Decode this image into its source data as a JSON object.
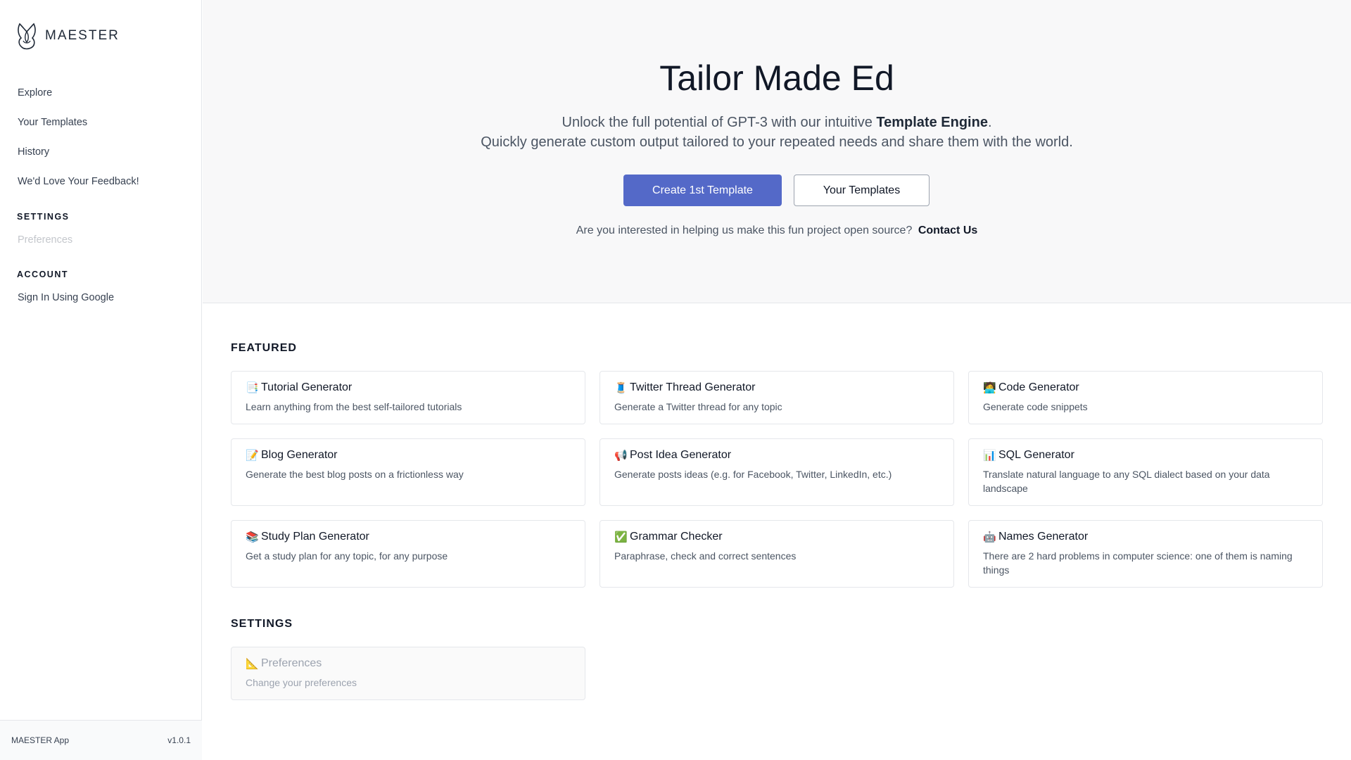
{
  "brand": {
    "name": "MAESTER"
  },
  "sidebar": {
    "nav": [
      {
        "label": "Explore"
      },
      {
        "label": "Your Templates"
      },
      {
        "label": "History"
      },
      {
        "label": "We'd Love Your Feedback!"
      }
    ],
    "settings_title": "SETTINGS",
    "preferences_label": "Preferences",
    "account_title": "ACCOUNT",
    "sign_in_label": "Sign In Using Google",
    "footer": {
      "app_name": "MAESTER App",
      "version": "v1.0.1"
    }
  },
  "hero": {
    "title": "Tailor Made Ed",
    "subtitle_line1_prefix": "Unlock the full potential of GPT-3 with our intuitive ",
    "subtitle_line1_bold": "Template Engine",
    "subtitle_line1_suffix": ".",
    "subtitle_line2": "Quickly generate custom output tailored to your repeated needs and share them with the world.",
    "primary_button": "Create 1st Template",
    "secondary_button": "Your Templates",
    "contact_text": "Are you interested in helping us make this fun project open source?",
    "contact_link": "Contact Us"
  },
  "featured": {
    "title": "FEATURED",
    "cards": [
      {
        "emoji": "📑",
        "title": "Tutorial Generator",
        "desc": "Learn anything from the best self-tailored tutorials"
      },
      {
        "emoji": "🧵",
        "title": "Twitter Thread Generator",
        "desc": "Generate a Twitter thread for any topic"
      },
      {
        "emoji": "🧑‍💻",
        "title": "Code Generator",
        "desc": "Generate code snippets"
      },
      {
        "emoji": "📝",
        "title": "Blog Generator",
        "desc": "Generate the best blog posts on a frictionless way"
      },
      {
        "emoji": "📢",
        "title": "Post Idea Generator",
        "desc": "Generate posts ideas (e.g. for Facebook, Twitter, LinkedIn, etc.)"
      },
      {
        "emoji": "📊",
        "title": "SQL Generator",
        "desc": "Translate natural language to any SQL dialect based on your data landscape"
      },
      {
        "emoji": "📚",
        "title": "Study Plan Generator",
        "desc": "Get a study plan for any topic, for any purpose"
      },
      {
        "emoji": "✅",
        "title": "Grammar Checker",
        "desc": "Paraphrase, check and correct sentences"
      },
      {
        "emoji": "🤖",
        "title": "Names Generator",
        "desc": "There are 2 hard problems in computer science: one of them is naming things"
      }
    ]
  },
  "settings_section": {
    "title": "SETTINGS",
    "card": {
      "emoji": "📐",
      "title": "Preferences",
      "desc": "Change your preferences"
    }
  },
  "colors": {
    "primary": "#5469c8",
    "hero_bg": "#f8f8f9"
  }
}
